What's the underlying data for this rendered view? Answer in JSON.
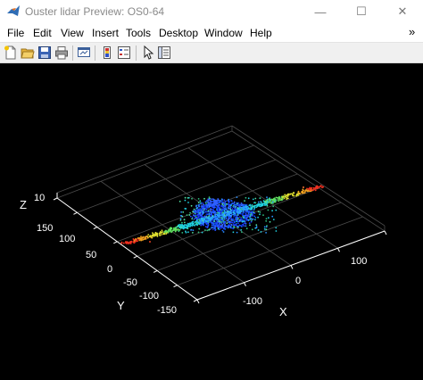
{
  "window": {
    "title": "Ouster lidar Preview: OS0-64",
    "controls": {
      "minimize": "—",
      "maximize": "☐",
      "close": "✕"
    }
  },
  "menu": [
    "File",
    "Edit",
    "View",
    "Insert",
    "Tools",
    "Desktop",
    "Window",
    "Help"
  ],
  "menu_right": "»",
  "toolbar": {
    "buttons": [
      "new-figure-icon",
      "open-file-icon",
      "save-icon",
      "print-icon",
      "link-plot-icon",
      "colorbar-icon",
      "legend-icon",
      "edit-plot-arrow-icon",
      "property-inspector-icon"
    ]
  },
  "plot": {
    "background": "#000000",
    "axes": {
      "x": {
        "label": "X",
        "ticks": [
          "-100",
          "0",
          "100"
        ]
      },
      "y": {
        "label": "Y",
        "ticks": [
          "150",
          "100",
          "50",
          "0",
          "-50",
          "-100",
          "-150"
        ]
      },
      "z": {
        "label": "Z",
        "ticks": [
          "10"
        ]
      }
    }
  }
}
